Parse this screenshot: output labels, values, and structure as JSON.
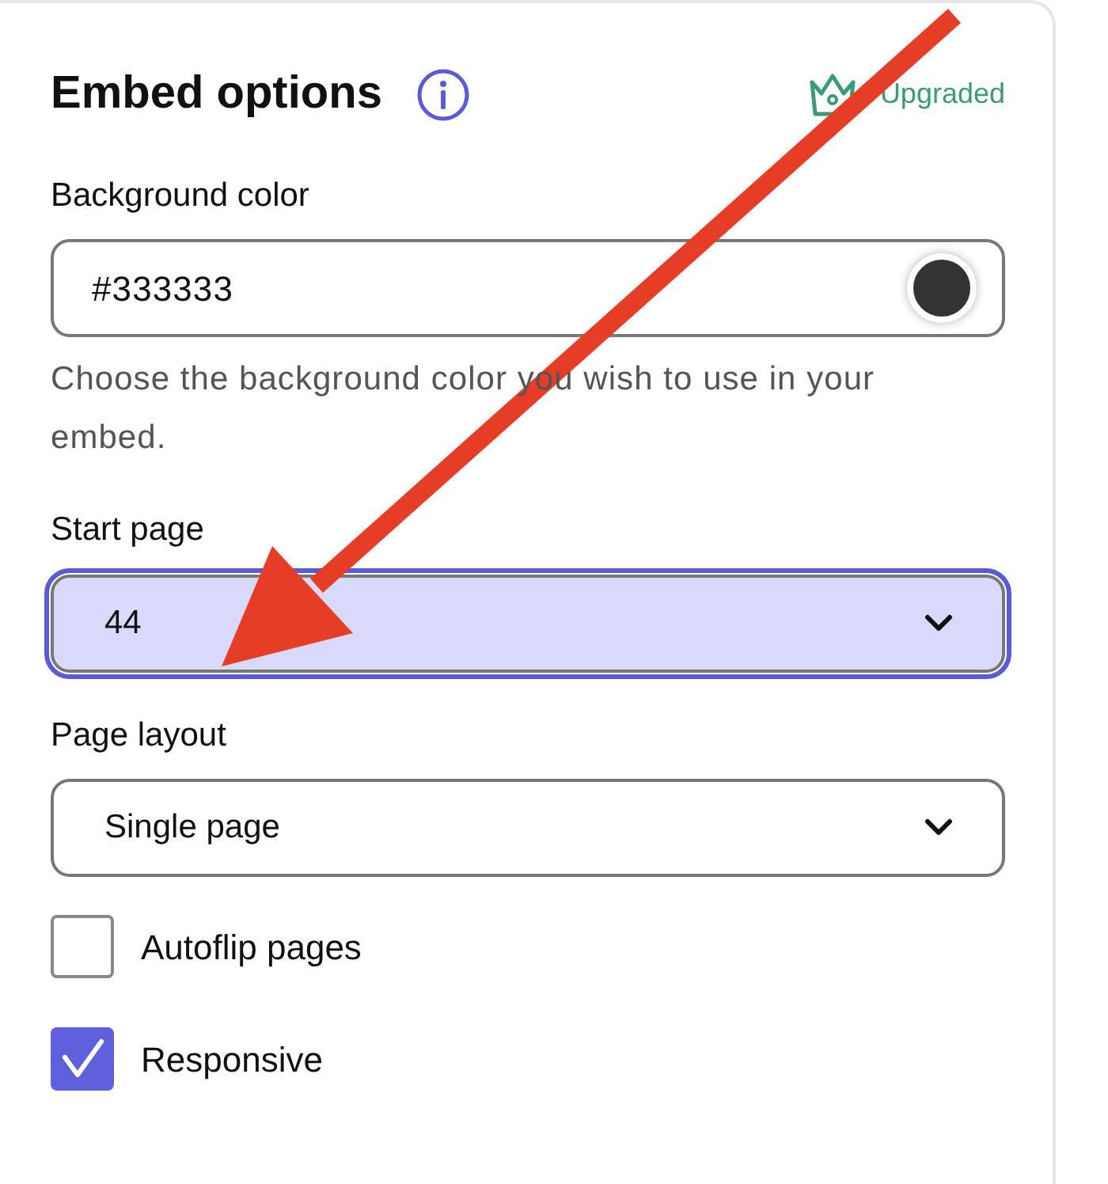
{
  "panel": {
    "title": "Embed options",
    "badge": "Upgraded"
  },
  "fields": [
    {
      "kind": "color",
      "label": "Background color",
      "value": "#333333",
      "help": "Choose the background color you wish to use in your embed.",
      "focused": false
    },
    {
      "kind": "select",
      "label": "Start page",
      "value": "44",
      "focused": true
    },
    {
      "kind": "select",
      "label": "Page layout",
      "value": "Single page",
      "focused": false
    }
  ],
  "options": [
    {
      "label": "Autoflip pages",
      "checked": false
    },
    {
      "label": "Responsive",
      "checked": true
    }
  ]
}
